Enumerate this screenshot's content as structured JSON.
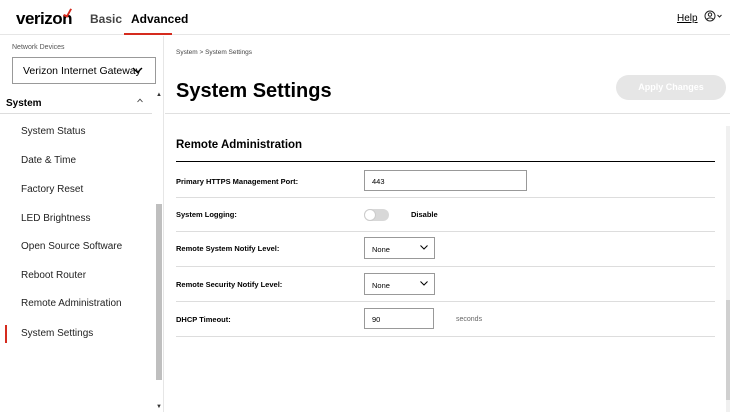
{
  "header": {
    "logo": "verizon",
    "tabs": [
      {
        "label": "Basic"
      },
      {
        "label": "Advanced"
      }
    ],
    "help": "Help",
    "accent_color": "#d52b1e"
  },
  "sidebar": {
    "device_label": "Network Devices",
    "device_selected": "Verizon Internet Gateway",
    "section": "System",
    "items": [
      {
        "label": "System Status"
      },
      {
        "label": "Date & Time"
      },
      {
        "label": "Factory Reset"
      },
      {
        "label": "LED Brightness"
      },
      {
        "label": "Open Source Software"
      },
      {
        "label": "Reboot Router"
      },
      {
        "label": "Remote Administration"
      },
      {
        "label": "System Settings"
      }
    ],
    "active_item": "System Settings"
  },
  "main": {
    "breadcrumb": "System  >  System Settings",
    "title": "System Settings",
    "apply_label": "Apply Changes",
    "section_title": "Remote Administration",
    "fields": {
      "https_port": {
        "label": "Primary HTTPS Management Port:",
        "value": "443"
      },
      "logging": {
        "label": "System Logging:",
        "state": "Disable",
        "on": false
      },
      "notify_level": {
        "label": "Remote System Notify Level:",
        "value": "None"
      },
      "security_level": {
        "label": "Remote Security Notify Level:",
        "value": "None"
      },
      "dhcp_timeout": {
        "label": "DHCP Timeout:",
        "value": "90",
        "unit": "seconds"
      }
    }
  }
}
